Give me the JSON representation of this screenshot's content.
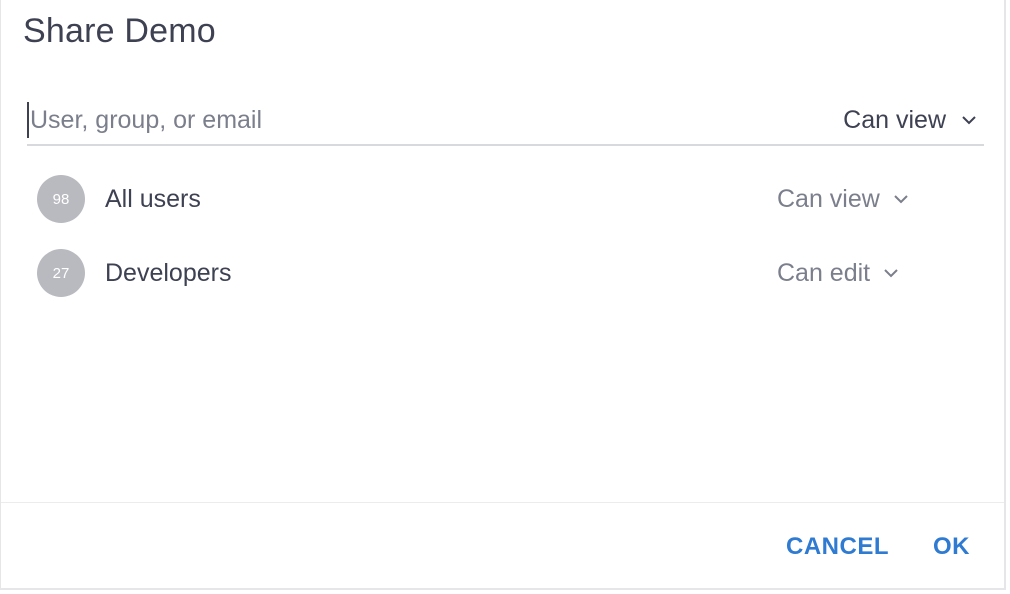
{
  "dialog": {
    "title": "Share Demo"
  },
  "search": {
    "placeholder": "User, group, or email",
    "permission": "Can view"
  },
  "shares": [
    {
      "count": "98",
      "name": "All users",
      "permission": "Can view"
    },
    {
      "count": "27",
      "name": "Developers",
      "permission": "Can edit"
    }
  ],
  "footer": {
    "cancel_label": "CANCEL",
    "ok_label": "OK"
  },
  "colors": {
    "accent": "#2f7bd2",
    "text": "#3d4152",
    "muted": "#7b7f8c",
    "avatar": "#b9bac0"
  }
}
